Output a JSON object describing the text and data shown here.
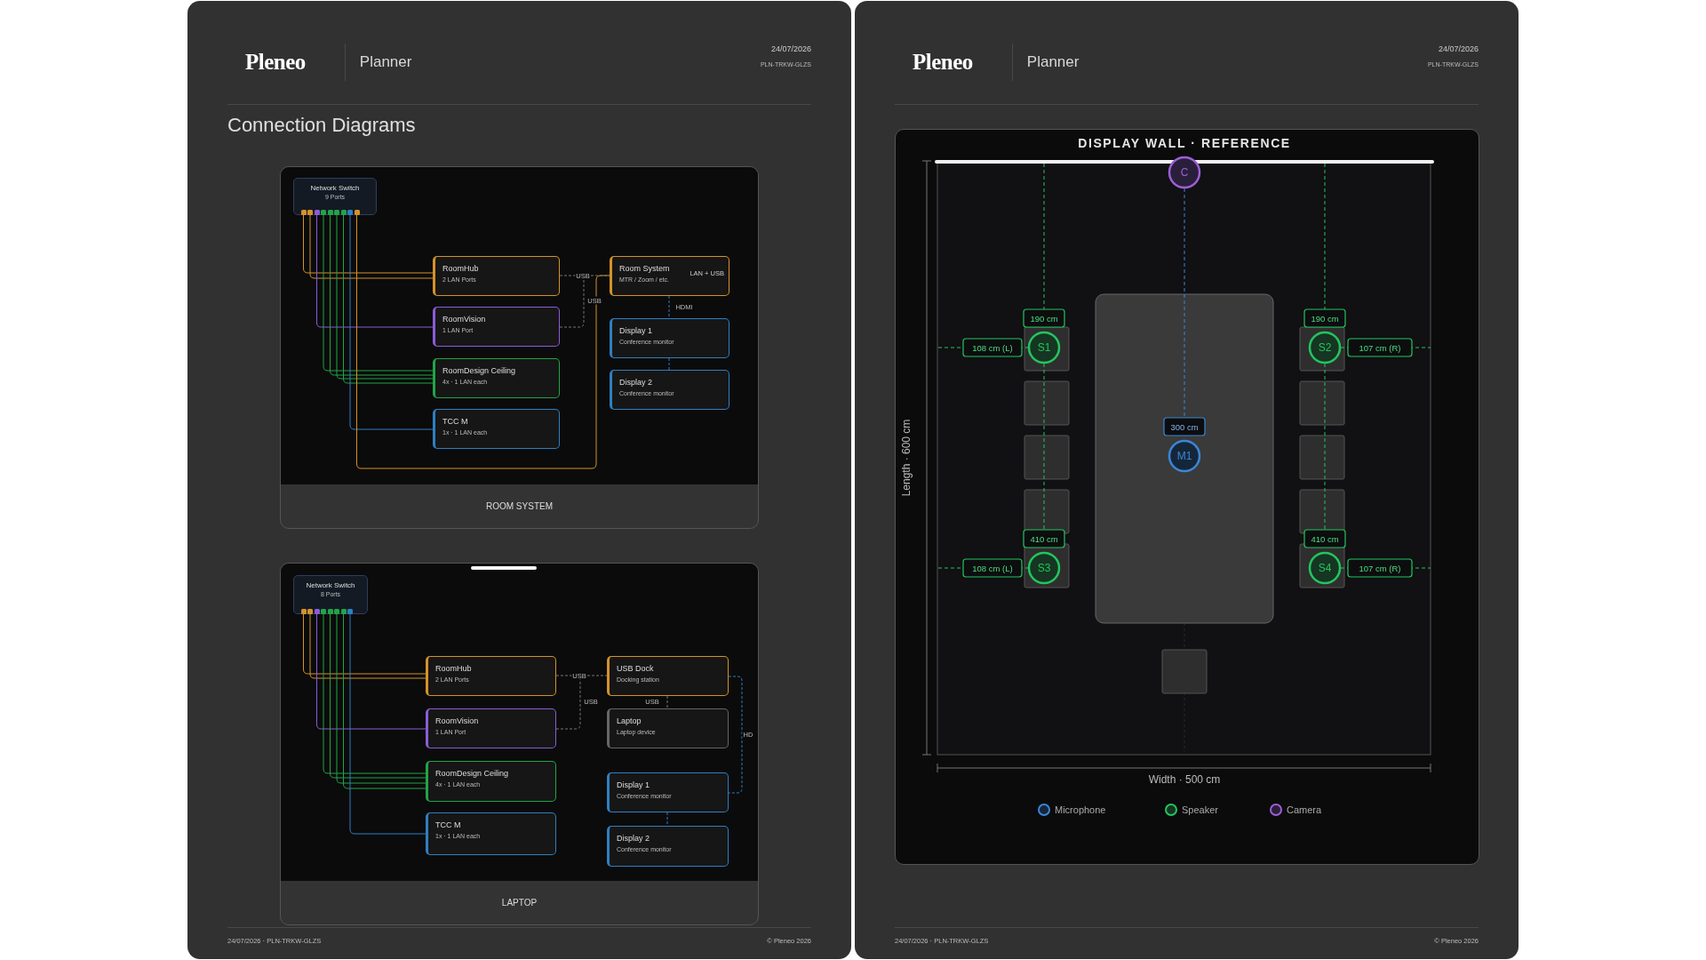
{
  "pages": [
    {
      "kind": "diagrams",
      "header": {
        "logo": "Pleneo",
        "app": "Planner",
        "date": "24/07/2026",
        "code": "PLN-TRKW-GLZS"
      },
      "title": "Connection Diagrams",
      "diagrams": [
        {
          "caption": "ROOM SYSTEM",
          "drag_handle": false,
          "switch": {
            "name": "Network Switch",
            "detail": "9 Ports",
            "ports": [
              {
                "color": "#d4922a"
              },
              {
                "color": "#d4922a"
              },
              {
                "color": "#8b5cd6"
              },
              {
                "color": "#22a447"
              },
              {
                "color": "#22a447"
              },
              {
                "color": "#22a447"
              },
              {
                "color": "#22a447"
              },
              {
                "color": "#2f7fc1"
              },
              {
                "color": "#d4922a"
              }
            ]
          },
          "nodes": [
            {
              "title": "RoomHub",
              "subtitle": "2 LAN Ports",
              "color": "#d4922a"
            },
            {
              "title": "RoomVision",
              "subtitle": "1 LAN Port",
              "color": "#8b5cd6"
            },
            {
              "title": "RoomDesign Ceiling",
              "subtitle": "4x · 1 LAN each",
              "color": "#22a447"
            },
            {
              "title": "TCC M",
              "subtitle": "1x · 1 LAN each",
              "color": "#2f7fc1"
            },
            {
              "title": "Room System",
              "subtitle": "MTR / Zoom / etc.",
              "tag": "LAN + USB",
              "color": "#d4922a"
            },
            {
              "title": "Display 1",
              "subtitle": "Conference monitor",
              "color": "#2f7fc1"
            },
            {
              "title": "Display 2",
              "subtitle": "Conference monitor",
              "color": "#2f7fc1"
            }
          ],
          "link_labels": [
            "USB",
            "USB",
            "HDMI"
          ]
        },
        {
          "caption": "LAPTOP",
          "drag_handle": true,
          "switch": {
            "name": "Network Switch",
            "detail": "8 Ports",
            "ports": [
              {
                "color": "#d4922a"
              },
              {
                "color": "#d4922a"
              },
              {
                "color": "#8b5cd6"
              },
              {
                "color": "#22a447"
              },
              {
                "color": "#22a447"
              },
              {
                "color": "#22a447"
              },
              {
                "color": "#22a447"
              },
              {
                "color": "#2f7fc1"
              }
            ]
          },
          "nodes": [
            {
              "title": "RoomHub",
              "subtitle": "2 LAN Ports",
              "color": "#d4922a"
            },
            {
              "title": "RoomVision",
              "subtitle": "1 LAN Port",
              "color": "#8b5cd6"
            },
            {
              "title": "RoomDesign Ceiling",
              "subtitle": "4x · 1 LAN each",
              "color": "#22a447"
            },
            {
              "title": "TCC M",
              "subtitle": "1x · 1 LAN each",
              "color": "#2f7fc1"
            },
            {
              "title": "USB Dock",
              "subtitle": "Docking station",
              "color": "#d4922a"
            },
            {
              "title": "Laptop",
              "subtitle": "Laptop device",
              "color": "#666666"
            },
            {
              "title": "Display 1",
              "subtitle": "Conference monitor",
              "color": "#2f7fc1"
            },
            {
              "title": "Display 2",
              "subtitle": "Conference monitor",
              "color": "#2f7fc1"
            }
          ],
          "link_labels": [
            "USB",
            "USB",
            "USB",
            "HD"
          ]
        }
      ],
      "footer": {
        "left": "24/07/2026 · PLN-TRKW-GLZS",
        "right": "© Pleneo 2026"
      }
    },
    {
      "kind": "room",
      "header": {
        "logo": "Pleneo",
        "app": "Planner",
        "date": "24/07/2026",
        "code": "PLN-TRKW-GLZS"
      },
      "room": {
        "title": "DISPLAY WALL · REFERENCE",
        "length_label": "Length · 600 cm",
        "width_label": "Width · 500 cm",
        "devices": [
          {
            "kind": "camera",
            "label": "C"
          },
          {
            "kind": "microphone",
            "label": "M1",
            "distance": "300 cm"
          },
          {
            "kind": "speaker",
            "label": "S1",
            "distance": "190 cm",
            "side_distance": "108 cm (L)"
          },
          {
            "kind": "speaker",
            "label": "S2",
            "distance": "190 cm",
            "side_distance": "107 cm (R)"
          },
          {
            "kind": "speaker",
            "label": "S3",
            "distance": "410 cm",
            "side_distance": "108 cm (L)"
          },
          {
            "kind": "speaker",
            "label": "S4",
            "distance": "410 cm",
            "side_distance": "107 cm (R)"
          }
        ],
        "legend": [
          {
            "kind": "microphone",
            "label": "Microphone"
          },
          {
            "kind": "speaker",
            "label": "Speaker"
          },
          {
            "kind": "camera",
            "label": "Camera"
          }
        ]
      },
      "footer": {
        "left": "24/07/2026 · PLN-TRKW-GLZS",
        "right": "© Pleneo 2026"
      }
    }
  ]
}
